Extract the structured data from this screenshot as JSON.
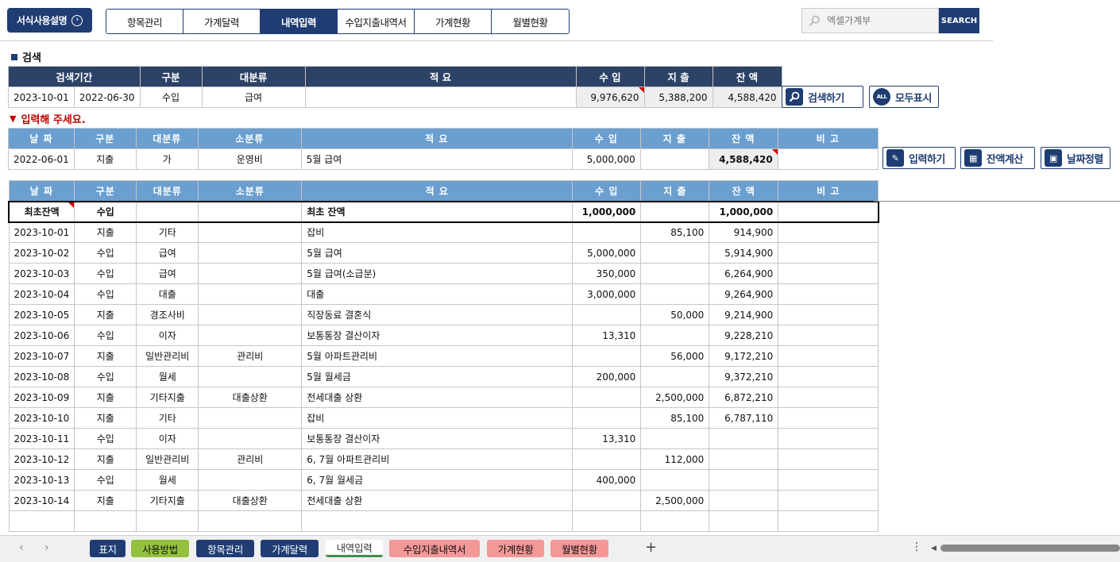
{
  "header": {
    "help_label": "서식사용설명",
    "nav_tabs": [
      "항목관리",
      "가계달력",
      "내역입력",
      "수입지출내역서",
      "가계현황",
      "월별현황"
    ],
    "active_tab": "내역입력",
    "search_placeholder": "엑셀가계부",
    "search_button": "SEARCH"
  },
  "search_section": {
    "label": "검색",
    "headers": [
      "검색기간",
      "구분",
      "대분류",
      "적 요",
      "수 입",
      "지 출",
      "잔 액"
    ],
    "row": [
      "2023-10-01",
      "2022-06-30",
      "수입",
      "급여",
      "",
      "9,976,620",
      "5,388,200",
      "4,588,420"
    ],
    "buttons": {
      "search": "검색하기",
      "show_all": "모두표시"
    }
  },
  "input_section": {
    "label": "입력해 주세요.",
    "headers": [
      "날 짜",
      "구분",
      "대분류",
      "소분류",
      "적 요",
      "수 입",
      "지 출",
      "잔 액",
      "비 고"
    ],
    "row": [
      "2022-06-01",
      "지출",
      "가",
      "운영비",
      "5월 급여",
      "5,000,000",
      "",
      "4,588,420",
      ""
    ],
    "buttons": {
      "input": "입력하기",
      "balance": "잔액계산",
      "sort": "날짜정렬"
    }
  },
  "list": {
    "headers": [
      "날 짜",
      "구분",
      "대분류",
      "소분류",
      "적 요",
      "수 입",
      "지 출",
      "잔 액",
      "비 고"
    ],
    "first_row": [
      "최초잔액",
      "수입",
      "",
      "",
      "최초 잔액",
      "1,000,000",
      "",
      "1,000,000",
      ""
    ],
    "rows": [
      [
        "2023-10-01",
        "지출",
        "기타",
        "",
        "잡비",
        "",
        "85,100",
        "914,900",
        ""
      ],
      [
        "2023-10-02",
        "수입",
        "급여",
        "",
        "5월 급여",
        "5,000,000",
        "",
        "5,914,900",
        ""
      ],
      [
        "2023-10-03",
        "수입",
        "급여",
        "",
        "5월 급여(소급분)",
        "350,000",
        "",
        "6,264,900",
        ""
      ],
      [
        "2023-10-04",
        "수입",
        "대출",
        "",
        "대출",
        "3,000,000",
        "",
        "9,264,900",
        ""
      ],
      [
        "2023-10-05",
        "지출",
        "경조사비",
        "",
        "직장동료 결혼식",
        "",
        "50,000",
        "9,214,900",
        ""
      ],
      [
        "2023-10-06",
        "수입",
        "이자",
        "",
        "보통통장 결산이자",
        "13,310",
        "",
        "9,228,210",
        ""
      ],
      [
        "2023-10-07",
        "지출",
        "일반관리비",
        "관리비",
        "5월 아파트관리비",
        "",
        "56,000",
        "9,172,210",
        ""
      ],
      [
        "2023-10-08",
        "수입",
        "월세",
        "",
        "5월 월세금",
        "200,000",
        "",
        "9,372,210",
        ""
      ],
      [
        "2023-10-09",
        "지출",
        "기타지출",
        "대출상환",
        "전세대출 상환",
        "",
        "2,500,000",
        "6,872,210",
        ""
      ],
      [
        "2023-10-10",
        "지출",
        "기타",
        "",
        "잡비",
        "",
        "85,100",
        "6,787,110",
        ""
      ],
      [
        "2023-10-11",
        "수입",
        "이자",
        "",
        "보통통장 결산이자",
        "13,310",
        "",
        "",
        ""
      ],
      [
        "2023-10-12",
        "지출",
        "일반관리비",
        "관리비",
        "6, 7월 아파트관리비",
        "",
        "112,000",
        "",
        ""
      ],
      [
        "2023-10-13",
        "수입",
        "월세",
        "",
        "6, 7월 월세금",
        "400,000",
        "",
        "",
        ""
      ],
      [
        "2023-10-14",
        "지출",
        "기타지출",
        "대출상환",
        "전세대출 상환",
        "",
        "2,500,000",
        "",
        ""
      ],
      [
        "",
        "",
        "",
        "",
        "",
        "",
        "",
        "",
        ""
      ]
    ]
  },
  "sheet_tabs": [
    {
      "label": "표지",
      "style": "navy"
    },
    {
      "label": "사용방법",
      "style": "green"
    },
    {
      "label": "항목관리",
      "style": "navy"
    },
    {
      "label": "가계달력",
      "style": "navy"
    },
    {
      "label": "내역입력",
      "style": "active"
    },
    {
      "label": "수입지출내역서",
      "style": "pink"
    },
    {
      "label": "가계현황",
      "style": "pink"
    },
    {
      "label": "월별현황",
      "style": "pink"
    }
  ],
  "colors": {
    "navy": "#1f3d73",
    "header_dark": "#2c4266",
    "header_light": "#6a9fd0",
    "warn": "#c00000",
    "green": "#92c23d",
    "pink": "#f49797"
  }
}
